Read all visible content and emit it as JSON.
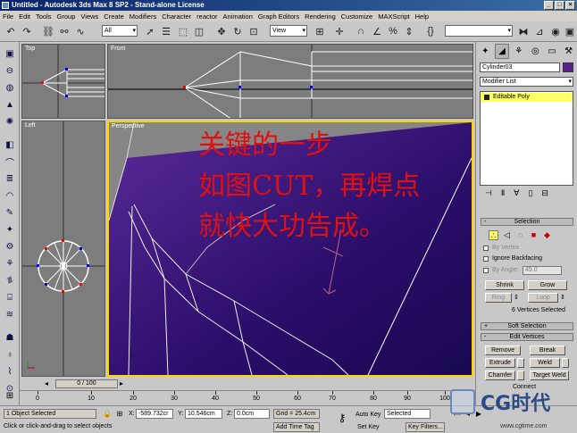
{
  "window": {
    "title": "Untitled - Autodesk 3ds Max 8 SP2 - Stand-alone License",
    "buttons": [
      "_",
      "□",
      "×"
    ]
  },
  "menu": [
    "File",
    "Edit",
    "Tools",
    "Group",
    "Views",
    "Create",
    "Modifiers",
    "Character",
    "reactor",
    "Animation",
    "Graph Editors",
    "Rendering",
    "Customize",
    "MAXScript",
    "Help"
  ],
  "toolbar": {
    "selection_filter": "All",
    "reference_coord": "View"
  },
  "viewports": {
    "top_label": "Top",
    "front_label": "Front",
    "left_label": "Left",
    "perspective_label": "Perspective"
  },
  "overlay": {
    "line1": "关键的一步",
    "line2": "如图CUT，再焊点",
    "line3": "就快大功告成。"
  },
  "command_panel": {
    "object_name": "Cylinder03",
    "object_color": "#5a1f8a",
    "modifier_list": "Modifier List",
    "stack_item": "Editable Poly",
    "selection_header": "Selection",
    "by_vertex": "By Vertex",
    "ignore_backfacing": "Ignore Backfacing",
    "by_angle": "By Angle:",
    "angle_value": "45.0",
    "shrink": "Shrink",
    "grow": "Grow",
    "ring": "Ring",
    "loop": "Loop",
    "selected_count": "6 Vertices Selected",
    "soft_selection": "Soft Selection",
    "edit_vertices": "Edit Vertices",
    "remove": "Remove",
    "break": "Break",
    "extrude": "Extrude",
    "weld": "Weld",
    "chamfer": "Chamfer",
    "target_weld": "Target Weld",
    "connect": "Connect"
  },
  "timeline": {
    "slider": "0 / 100",
    "ticks": [
      "0",
      "10",
      "20",
      "30",
      "40",
      "50",
      "60",
      "70",
      "80",
      "90",
      "100"
    ]
  },
  "status": {
    "selected": "1 Object Selected",
    "prompt": "Click or click-and-drag to select objects",
    "x_label": "X:",
    "x_value": "-589.732cr",
    "y_label": "Y:",
    "y_value": "10.546cm",
    "z_label": "Z:",
    "z_value": "0.0cm",
    "grid": "Grid = 25.4cm",
    "add_time_tag": "Add Time Tag",
    "auto_key": "Auto Key",
    "auto_key_mode": "Selected",
    "set_key": "Set Key",
    "key_filters": "Key Filters..."
  },
  "watermark": {
    "brand": "CG时代",
    "url": "www.cgtime.com"
  }
}
